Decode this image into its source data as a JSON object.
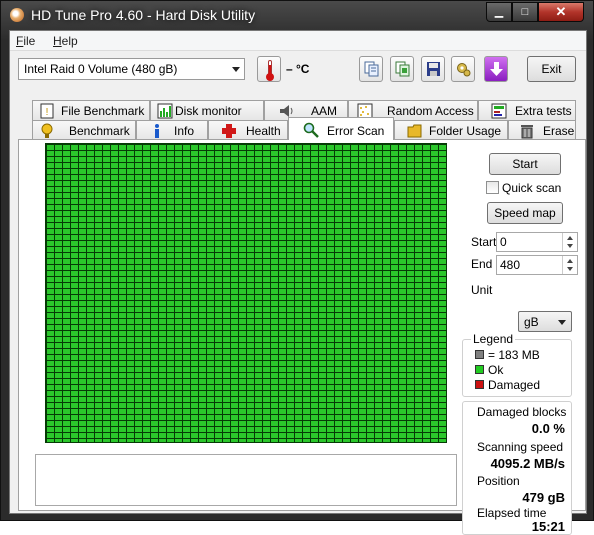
{
  "window": {
    "title": "HD Tune Pro 4.60 - Hard Disk Utility"
  },
  "menu": {
    "file": "File",
    "file_key": "F",
    "file_rest": "ile",
    "help": "Help",
    "help_key": "H",
    "help_rest": "elp"
  },
  "toolbar": {
    "drive": "Intel   Raid 0 Volume (480 gB)",
    "temperature": "– °C",
    "exit_label": "Exit"
  },
  "tabs_top": [
    {
      "label": "File Benchmark",
      "icon": "file-benchmark-icon"
    },
    {
      "label": "Disk monitor",
      "icon": "disk-monitor-icon"
    },
    {
      "label": "AAM",
      "icon": "speaker-icon"
    },
    {
      "label": "Random Access",
      "icon": "random-access-icon"
    },
    {
      "label": "Extra tests",
      "icon": "extra-tests-icon"
    }
  ],
  "tabs_bottom": [
    {
      "label": "Benchmark",
      "icon": "benchmark-icon"
    },
    {
      "label": "Info",
      "icon": "info-icon"
    },
    {
      "label": "Health",
      "icon": "health-icon"
    },
    {
      "label": "Error Scan",
      "icon": "magnifier-icon",
      "active": true
    },
    {
      "label": "Folder Usage",
      "icon": "folder-icon"
    },
    {
      "label": "Erase",
      "icon": "trash-icon"
    }
  ],
  "scan": {
    "start_button": "Start",
    "quick_scan_label": "Quick scan",
    "quick_scan_checked": false,
    "speed_map_button": "Speed map",
    "start_label": "Start",
    "start_value": "0",
    "end_label": "End",
    "end_value": "480",
    "unit_label": "Unit",
    "unit_value": "gB",
    "block_color_ok": "#2bc72b"
  },
  "legend": {
    "title": "Legend",
    "block_size": "= 183 MB",
    "ok": "Ok",
    "damaged": "Damaged",
    "colors": {
      "block": "#808080",
      "ok": "#22cc22",
      "damaged": "#cc1111"
    }
  },
  "stats": {
    "damaged_label": "Damaged blocks",
    "damaged_value": "0.0 %",
    "speed_label": "Scanning speed",
    "speed_value": "4095.2 MB/s",
    "position_label": "Position",
    "position_value": "479 gB",
    "elapsed_label": "Elapsed time",
    "elapsed_value": "15:21"
  }
}
